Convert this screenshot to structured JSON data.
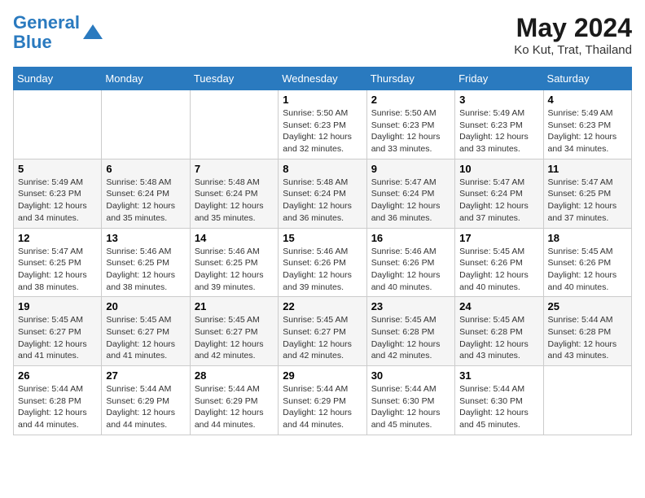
{
  "header": {
    "logo_line1": "General",
    "logo_line2": "Blue",
    "month_year": "May 2024",
    "location": "Ko Kut, Trat, Thailand"
  },
  "weekdays": [
    "Sunday",
    "Monday",
    "Tuesday",
    "Wednesday",
    "Thursday",
    "Friday",
    "Saturday"
  ],
  "weeks": [
    [
      null,
      null,
      null,
      {
        "day": 1,
        "sunrise": "5:50 AM",
        "sunset": "6:23 PM",
        "daylight": "12 hours and 32 minutes."
      },
      {
        "day": 2,
        "sunrise": "5:50 AM",
        "sunset": "6:23 PM",
        "daylight": "12 hours and 33 minutes."
      },
      {
        "day": 3,
        "sunrise": "5:49 AM",
        "sunset": "6:23 PM",
        "daylight": "12 hours and 33 minutes."
      },
      {
        "day": 4,
        "sunrise": "5:49 AM",
        "sunset": "6:23 PM",
        "daylight": "12 hours and 34 minutes."
      }
    ],
    [
      {
        "day": 5,
        "sunrise": "5:49 AM",
        "sunset": "6:23 PM",
        "daylight": "12 hours and 34 minutes."
      },
      {
        "day": 6,
        "sunrise": "5:48 AM",
        "sunset": "6:24 PM",
        "daylight": "12 hours and 35 minutes."
      },
      {
        "day": 7,
        "sunrise": "5:48 AM",
        "sunset": "6:24 PM",
        "daylight": "12 hours and 35 minutes."
      },
      {
        "day": 8,
        "sunrise": "5:48 AM",
        "sunset": "6:24 PM",
        "daylight": "12 hours and 36 minutes."
      },
      {
        "day": 9,
        "sunrise": "5:47 AM",
        "sunset": "6:24 PM",
        "daylight": "12 hours and 36 minutes."
      },
      {
        "day": 10,
        "sunrise": "5:47 AM",
        "sunset": "6:24 PM",
        "daylight": "12 hours and 37 minutes."
      },
      {
        "day": 11,
        "sunrise": "5:47 AM",
        "sunset": "6:25 PM",
        "daylight": "12 hours and 37 minutes."
      }
    ],
    [
      {
        "day": 12,
        "sunrise": "5:47 AM",
        "sunset": "6:25 PM",
        "daylight": "12 hours and 38 minutes."
      },
      {
        "day": 13,
        "sunrise": "5:46 AM",
        "sunset": "6:25 PM",
        "daylight": "12 hours and 38 minutes."
      },
      {
        "day": 14,
        "sunrise": "5:46 AM",
        "sunset": "6:25 PM",
        "daylight": "12 hours and 39 minutes."
      },
      {
        "day": 15,
        "sunrise": "5:46 AM",
        "sunset": "6:26 PM",
        "daylight": "12 hours and 39 minutes."
      },
      {
        "day": 16,
        "sunrise": "5:46 AM",
        "sunset": "6:26 PM",
        "daylight": "12 hours and 40 minutes."
      },
      {
        "day": 17,
        "sunrise": "5:45 AM",
        "sunset": "6:26 PM",
        "daylight": "12 hours and 40 minutes."
      },
      {
        "day": 18,
        "sunrise": "5:45 AM",
        "sunset": "6:26 PM",
        "daylight": "12 hours and 40 minutes."
      }
    ],
    [
      {
        "day": 19,
        "sunrise": "5:45 AM",
        "sunset": "6:27 PM",
        "daylight": "12 hours and 41 minutes."
      },
      {
        "day": 20,
        "sunrise": "5:45 AM",
        "sunset": "6:27 PM",
        "daylight": "12 hours and 41 minutes."
      },
      {
        "day": 21,
        "sunrise": "5:45 AM",
        "sunset": "6:27 PM",
        "daylight": "12 hours and 42 minutes."
      },
      {
        "day": 22,
        "sunrise": "5:45 AM",
        "sunset": "6:27 PM",
        "daylight": "12 hours and 42 minutes."
      },
      {
        "day": 23,
        "sunrise": "5:45 AM",
        "sunset": "6:28 PM",
        "daylight": "12 hours and 42 minutes."
      },
      {
        "day": 24,
        "sunrise": "5:45 AM",
        "sunset": "6:28 PM",
        "daylight": "12 hours and 43 minutes."
      },
      {
        "day": 25,
        "sunrise": "5:44 AM",
        "sunset": "6:28 PM",
        "daylight": "12 hours and 43 minutes."
      }
    ],
    [
      {
        "day": 26,
        "sunrise": "5:44 AM",
        "sunset": "6:28 PM",
        "daylight": "12 hours and 44 minutes."
      },
      {
        "day": 27,
        "sunrise": "5:44 AM",
        "sunset": "6:29 PM",
        "daylight": "12 hours and 44 minutes."
      },
      {
        "day": 28,
        "sunrise": "5:44 AM",
        "sunset": "6:29 PM",
        "daylight": "12 hours and 44 minutes."
      },
      {
        "day": 29,
        "sunrise": "5:44 AM",
        "sunset": "6:29 PM",
        "daylight": "12 hours and 44 minutes."
      },
      {
        "day": 30,
        "sunrise": "5:44 AM",
        "sunset": "6:30 PM",
        "daylight": "12 hours and 45 minutes."
      },
      {
        "day": 31,
        "sunrise": "5:44 AM",
        "sunset": "6:30 PM",
        "daylight": "12 hours and 45 minutes."
      },
      null
    ]
  ],
  "labels": {
    "sunrise": "Sunrise:",
    "sunset": "Sunset:",
    "daylight": "Daylight:"
  }
}
